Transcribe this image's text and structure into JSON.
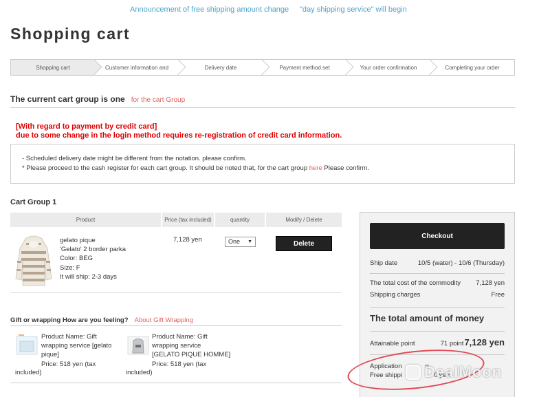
{
  "announcements": [
    {
      "text": "Announcement of free shipping amount change"
    },
    {
      "text": "\"day shipping service\" will begin"
    }
  ],
  "page_title": "Shopping cart",
  "steps": [
    {
      "label": "Shopping cart",
      "active": true
    },
    {
      "label": "Customer information and",
      "active": false
    },
    {
      "label": "Delivery date",
      "active": false
    },
    {
      "label": "Payment method set",
      "active": false
    },
    {
      "label": "Your order confirmation",
      "active": false
    },
    {
      "label": "Completing your order",
      "active": false
    }
  ],
  "cart_group_heading": {
    "text": "The current cart group is one",
    "link": "for the cart Group"
  },
  "credit_notice": {
    "line1": "[With regard to payment by credit card]",
    "line2": "due to some change in the login method requires re-registration of credit card information."
  },
  "notes": {
    "line1": "- Scheduled delivery date might be different from the notation. please confirm.",
    "line2_prefix": "* Please proceed to the cash register for each cart group. It should be noted that, for the cart group ",
    "line2_link": "here",
    "line2_suffix": " Please confirm."
  },
  "cart_group_title": "Cart Group 1",
  "table": {
    "headers": {
      "product": "Product",
      "price": "Price (tax included)",
      "quantity": "quantity",
      "modify": "Modify / Delete"
    },
    "item": {
      "brand": "gelato pique",
      "name": "'Gelato' 2 border parka",
      "color": "Color: BEG",
      "size": "Size: F",
      "ship": "It will ship: 2-3 days",
      "price": "7,128 yen",
      "quantity": "One",
      "delete_label": "Delete"
    }
  },
  "gift": {
    "heading": "Gift or wrapping How are you feeling?",
    "link": "About Gift Wrapping",
    "items": [
      {
        "l1": "Product Name: Gift",
        "l2": "wrapping service [gelato",
        "l3": "pique]",
        "l4": "Price: 518 yen (tax",
        "l5": "included)"
      },
      {
        "l1": "Product Name: Gift",
        "l2": "wrapping service",
        "l3": "[GELATO PIQUE HOMME]",
        "l4": "Price: 518 yen (tax",
        "l5": "included)"
      }
    ]
  },
  "summary": {
    "checkout_label": "Checkout",
    "ship_date_label": "Ship date",
    "ship_date_value": "10/5 (water) - 10/6 (Thursday)",
    "commodity_label": "The total cost of the commodity",
    "commodity_value": "7,128 yen",
    "shipping_label": "Shipping charges",
    "shipping_value": "Free",
    "total_label": "The total amount of money",
    "attainable_label": "Attainable point",
    "points": "71 point",
    "total_value": "7,128 yen",
    "application_text": "Application",
    "application_tail": "n",
    "free_shipping_text": "Free shippi",
    "free_shipping_tail": "0 yen"
  },
  "watermark": "DealMoon",
  "colors": {
    "link": "#e0605e",
    "announce": "#4aa3c9",
    "notice": "#e00000",
    "button": "#222222"
  }
}
